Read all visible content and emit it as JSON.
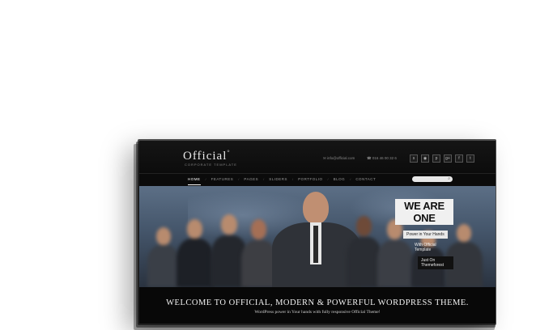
{
  "header": {
    "logo": "Official",
    "logo_mark": "°",
    "tagline": "CORPORATE TEMPLATE",
    "email": "✉ info@official.com",
    "phone": "☎ 016 46 00 32 6"
  },
  "socials": [
    "skype-icon",
    "dribbble-icon",
    "pinterest-icon",
    "googleplus-icon",
    "facebook-icon",
    "twitter-icon"
  ],
  "social_glyphs": [
    "s",
    "◉",
    "p",
    "g+",
    "f",
    "t"
  ],
  "nav": {
    "items": [
      "HOME",
      "FEATURES",
      "PAGES",
      "SLIDERS",
      "PORTFOLIO",
      "BLOG",
      "CONTACT"
    ],
    "active": "HOME"
  },
  "search": {
    "placeholder": "",
    "icon": "⌕"
  },
  "hero": {
    "headline": "WE ARE ONE",
    "caption1": "Power in Your Hands",
    "caption2": "With Official Template",
    "caption3": "Just On Themeforest"
  },
  "welcome": {
    "title": "Welcome to Official, modern & powerful wordpress theme.",
    "subtitle": "WordPress power in Your hands with fully responsive Official Theme!"
  }
}
